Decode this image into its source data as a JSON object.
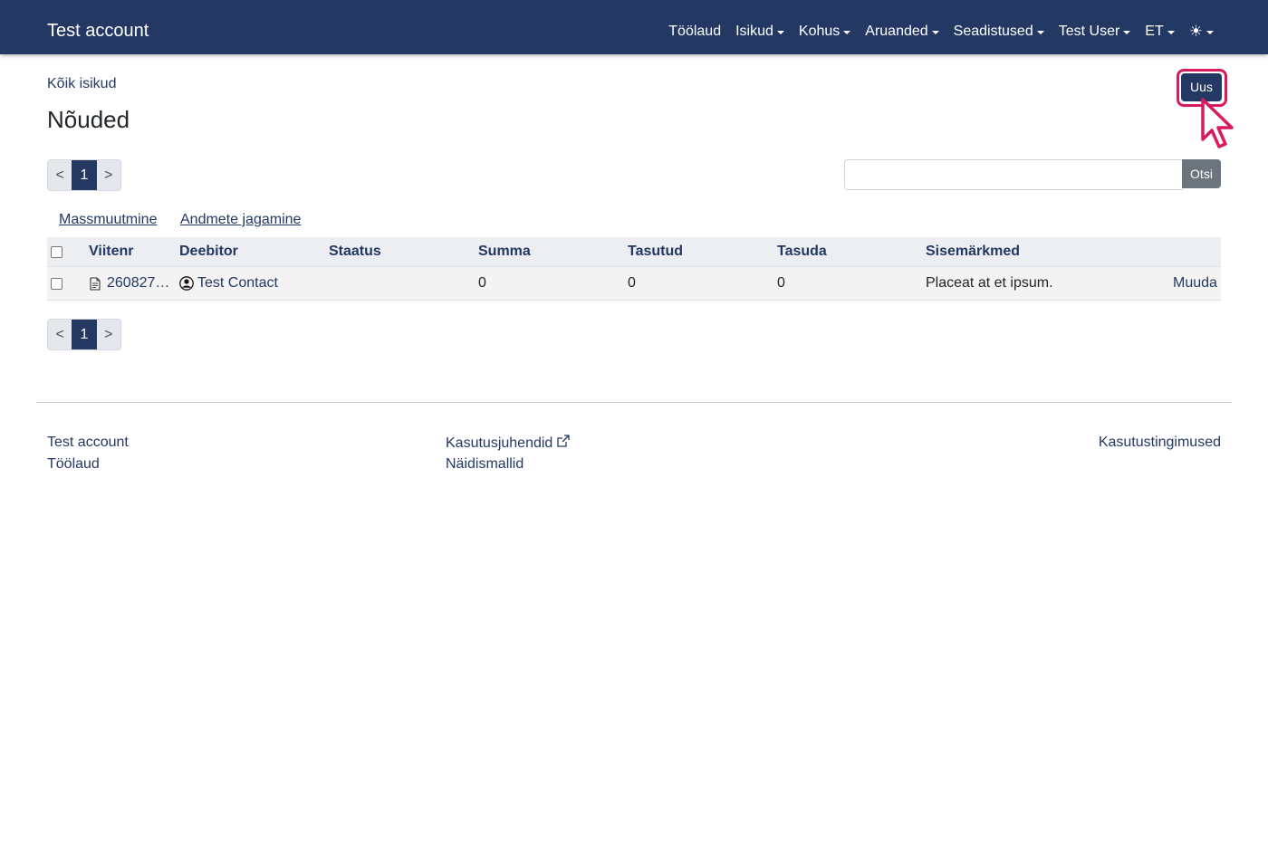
{
  "navbar": {
    "brand": "Test account",
    "items": [
      {
        "label": "Töölaud",
        "dropdown": false
      },
      {
        "label": "Isikud",
        "dropdown": true
      },
      {
        "label": "Kohus",
        "dropdown": true
      },
      {
        "label": "Aruanded",
        "dropdown": true
      },
      {
        "label": "Seadistused",
        "dropdown": true
      },
      {
        "label": "Test User",
        "dropdown": true
      },
      {
        "label": "ET",
        "dropdown": true
      }
    ],
    "theme_icon": "sun-icon",
    "theme_glyph": "☀"
  },
  "breadcrumb": "Kõik isikud",
  "page_title": "Nõuded",
  "new_button": "Uus",
  "pagination": {
    "prev": "<",
    "current": "1",
    "next": ">"
  },
  "search": {
    "value": "",
    "placeholder": "",
    "button": "Otsi"
  },
  "actions": {
    "mass_edit": "Massmuutmine",
    "data_sharing": "Andmete jagamine"
  },
  "table": {
    "columns": [
      "Viitenr",
      "Deebitor",
      "Staatus",
      "Summa",
      "Tasutud",
      "Tasuda",
      "Sisemärkmed"
    ],
    "rows": [
      {
        "reference": "260827…",
        "debtor": "Test Contact",
        "status": "",
        "amount": "0",
        "paid": "0",
        "due": "0",
        "notes": "Placeat at et ipsum.",
        "action": "Muuda"
      }
    ]
  },
  "footer": {
    "col1": [
      "Test account",
      "Töölaud"
    ],
    "col2": [
      "Kasutusjuhendid",
      "Näidismallid"
    ],
    "col3": [
      "Kasutustingimused"
    ]
  },
  "colors": {
    "navbar": "#233863",
    "highlight": "#d81b60",
    "search_button": "#6c757d"
  }
}
